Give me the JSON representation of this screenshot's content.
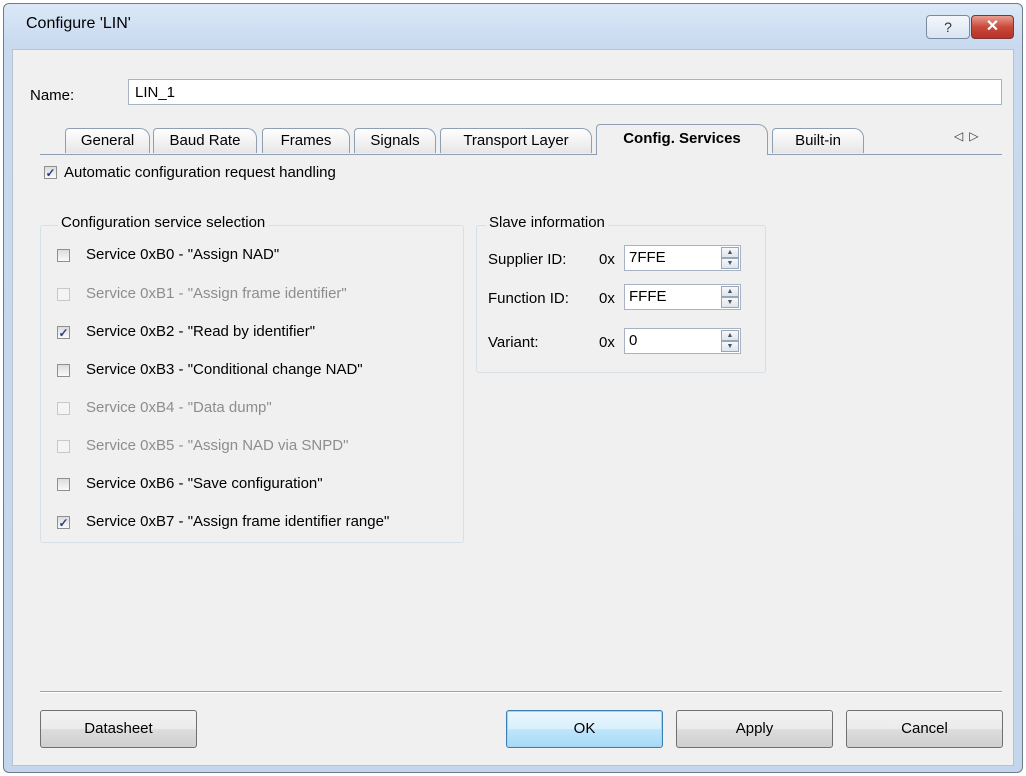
{
  "window": {
    "title": "Configure 'LIN'",
    "help_glyph": "?",
    "close_glyph": "✕"
  },
  "name": {
    "label": "Name:",
    "value": "LIN_1"
  },
  "tabs": [
    {
      "label": "General"
    },
    {
      "label": "Baud Rate"
    },
    {
      "label": "Frames"
    },
    {
      "label": "Signals"
    },
    {
      "label": "Transport Layer"
    },
    {
      "label": "Config. Services",
      "active": true
    },
    {
      "label": "Built-in"
    }
  ],
  "tab_scroll": {
    "left": "◁",
    "right": "▷"
  },
  "auto_handling": {
    "label": "Automatic configuration request handling",
    "checked": true
  },
  "services_group": {
    "title": "Configuration service selection",
    "items": [
      {
        "label": "Service 0xB0 - \"Assign NAD\"",
        "checked": false,
        "enabled": true
      },
      {
        "label": "Service 0xB1 - \"Assign frame identifier\"",
        "checked": false,
        "enabled": false
      },
      {
        "label": "Service 0xB2 - \"Read by identifier\"",
        "checked": true,
        "enabled": true
      },
      {
        "label": "Service 0xB3 - \"Conditional change NAD\"",
        "checked": false,
        "enabled": true
      },
      {
        "label": "Service 0xB4 - \"Data dump\"",
        "checked": false,
        "enabled": false
      },
      {
        "label": "Service 0xB5 - \"Assign NAD via SNPD\"",
        "checked": false,
        "enabled": false
      },
      {
        "label": "Service 0xB6 - \"Save configuration\"",
        "checked": false,
        "enabled": true
      },
      {
        "label": "Service 0xB7 - \"Assign frame identifier range\"",
        "checked": true,
        "enabled": true
      }
    ]
  },
  "slave_group": {
    "title": "Slave information",
    "fields": [
      {
        "label": "Supplier ID:",
        "prefix": "0x",
        "value": "7FFE"
      },
      {
        "label": "Function ID:",
        "prefix": "0x",
        "value": "FFFE"
      },
      {
        "label": "Variant:",
        "prefix": "0x",
        "value": "0"
      }
    ]
  },
  "buttons": {
    "datasheet": "Datasheet",
    "ok": "OK",
    "apply": "Apply",
    "cancel": "Cancel"
  },
  "check_glyph": "✓",
  "spin_up_glyph": "▲",
  "spin_down_glyph": "▼",
  "colors": {
    "title_bar": "#c9daef",
    "close_button": "#c9493a",
    "dialog_bg": "#f0f0f0",
    "check": "#2b3e8c"
  }
}
